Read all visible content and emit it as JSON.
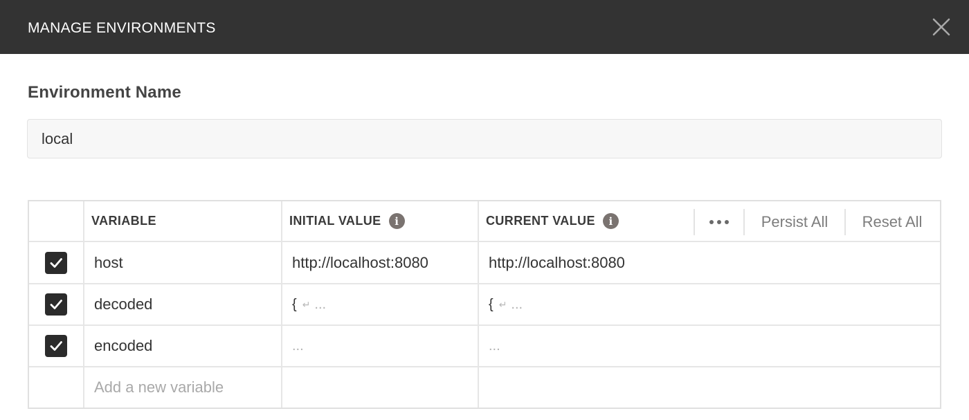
{
  "dialog": {
    "title": "MANAGE ENVIRONMENTS",
    "close_icon": "close-icon"
  },
  "environment": {
    "label": "Environment Name",
    "value": "local"
  },
  "table": {
    "headers": {
      "variable": "VARIABLE",
      "initial_value": "INITIAL VALUE",
      "current_value": "CURRENT VALUE",
      "info_glyph": "i"
    },
    "actions": {
      "more_icon": "ellipsis-icon",
      "persist_all": "Persist All",
      "reset_all": "Reset All"
    },
    "rows": [
      {
        "enabled": true,
        "variable": "host",
        "initial": "http://localhost:8080",
        "current": "http://localhost:8080"
      },
      {
        "enabled": true,
        "variable": "decoded",
        "initial_prefix": "{",
        "initial_newline": "↵",
        "initial_more": "...",
        "current_prefix": "{",
        "current_newline": "↵",
        "current_more": "..."
      },
      {
        "enabled": true,
        "variable": "encoded",
        "initial_more": "...",
        "current_more": "..."
      }
    ],
    "new_variable_placeholder": "Add a new variable"
  },
  "colors": {
    "titlebar_bg": "#333333",
    "checkbox_bg": "#2b2b2b",
    "info_icon_bg": "#7a7370"
  }
}
